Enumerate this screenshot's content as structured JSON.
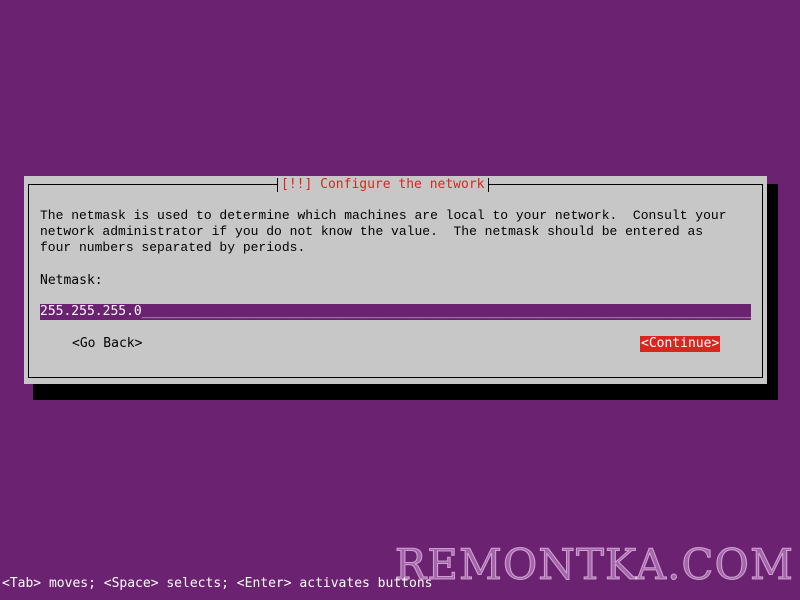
{
  "dialog": {
    "title": "[!!] Configure the network",
    "description": "The netmask is used to determine which machines are local to your network.  Consult your\nnetwork administrator if you do not know the value.  The netmask should be entered as\nfour numbers separated by periods.",
    "field_label": "Netmask:",
    "field_value": "255.255.255.0",
    "field_fill": "_______________________________________________________________________________________",
    "go_back_label": "<Go Back>",
    "continue_label": "<Continue>"
  },
  "status_bar": "<Tab> moves; <Space> selects; <Enter> activates buttons",
  "watermark": "REMONTKA.COM",
  "colors": {
    "background": "#6b2371",
    "dialog": "#c7c7c7",
    "accent": "#d7271e"
  }
}
